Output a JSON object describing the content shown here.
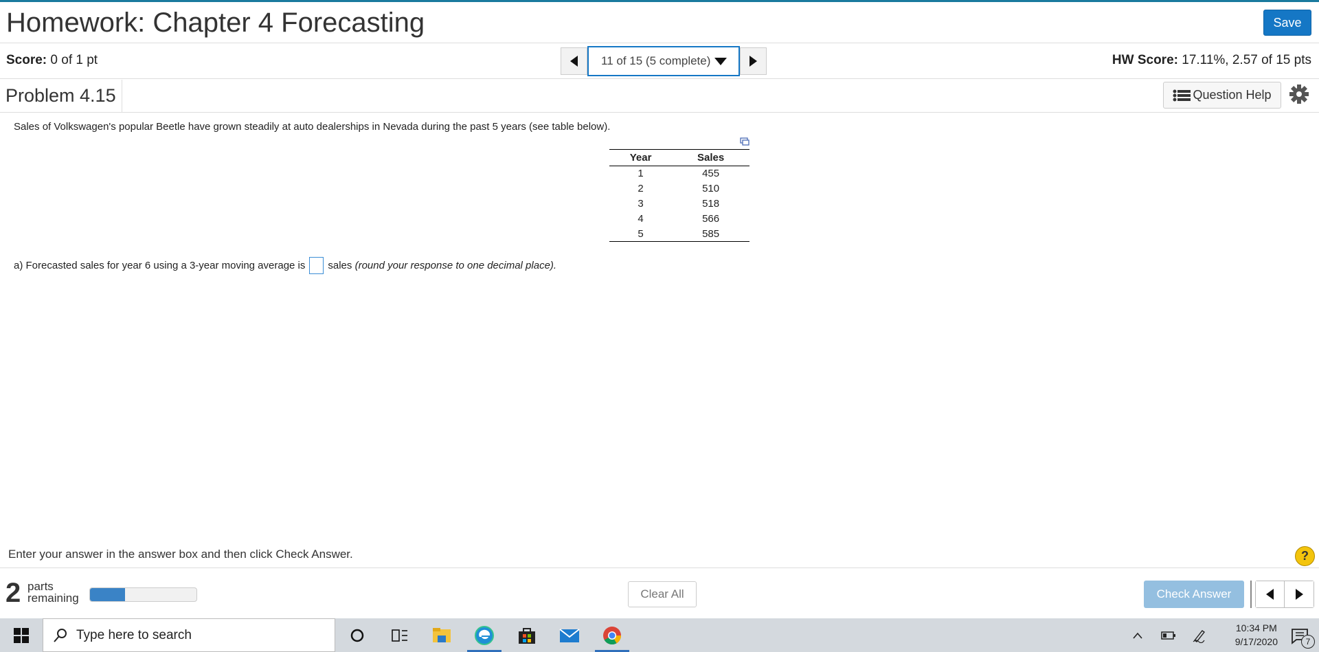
{
  "header": {
    "title": "Homework: Chapter 4 Forecasting",
    "save_label": "Save"
  },
  "scorebar": {
    "score_label": "Score:",
    "score_value": "0 of 1 pt",
    "nav_selected": "11 of 15 (5 complete)",
    "hw_score_label": "HW Score:",
    "hw_score_value": "17.11%, 2.57 of 15 pts"
  },
  "problem": {
    "title": "Problem 4.15",
    "help_label": "Question Help"
  },
  "question": {
    "intro": "Sales of Volkswagen's popular Beetle have grown steadily at auto dealerships in Nevada during the past 5 years (see table below).",
    "table": {
      "headers": [
        "Year",
        "Sales"
      ],
      "rows": [
        [
          "1",
          "455"
        ],
        [
          "2",
          "510"
        ],
        [
          "3",
          "518"
        ],
        [
          "4",
          "566"
        ],
        [
          "5",
          "585"
        ]
      ]
    },
    "part_a_prefix": "a) Forecasted sales for year 6 using a 3-year moving average is",
    "part_a_suffix": "sales",
    "part_a_hint": "(round your response to one decimal place)."
  },
  "instructions": "Enter your answer in the answer box and then click Check Answer.",
  "footer": {
    "parts_count": "2",
    "parts_label_1": "parts",
    "parts_label_2": "remaining",
    "progress_fraction": 0.33,
    "clear_label": "Clear All",
    "check_label": "Check Answer"
  },
  "taskbar": {
    "search_placeholder": "Type here to search",
    "time": "10:34 PM",
    "date": "9/17/2020",
    "notification_count": "7"
  },
  "colors": {
    "accent": "#1577c5",
    "check_disabled": "#94bfe0",
    "progress": "#3a83c6",
    "top_line": "#1a7a9e"
  }
}
